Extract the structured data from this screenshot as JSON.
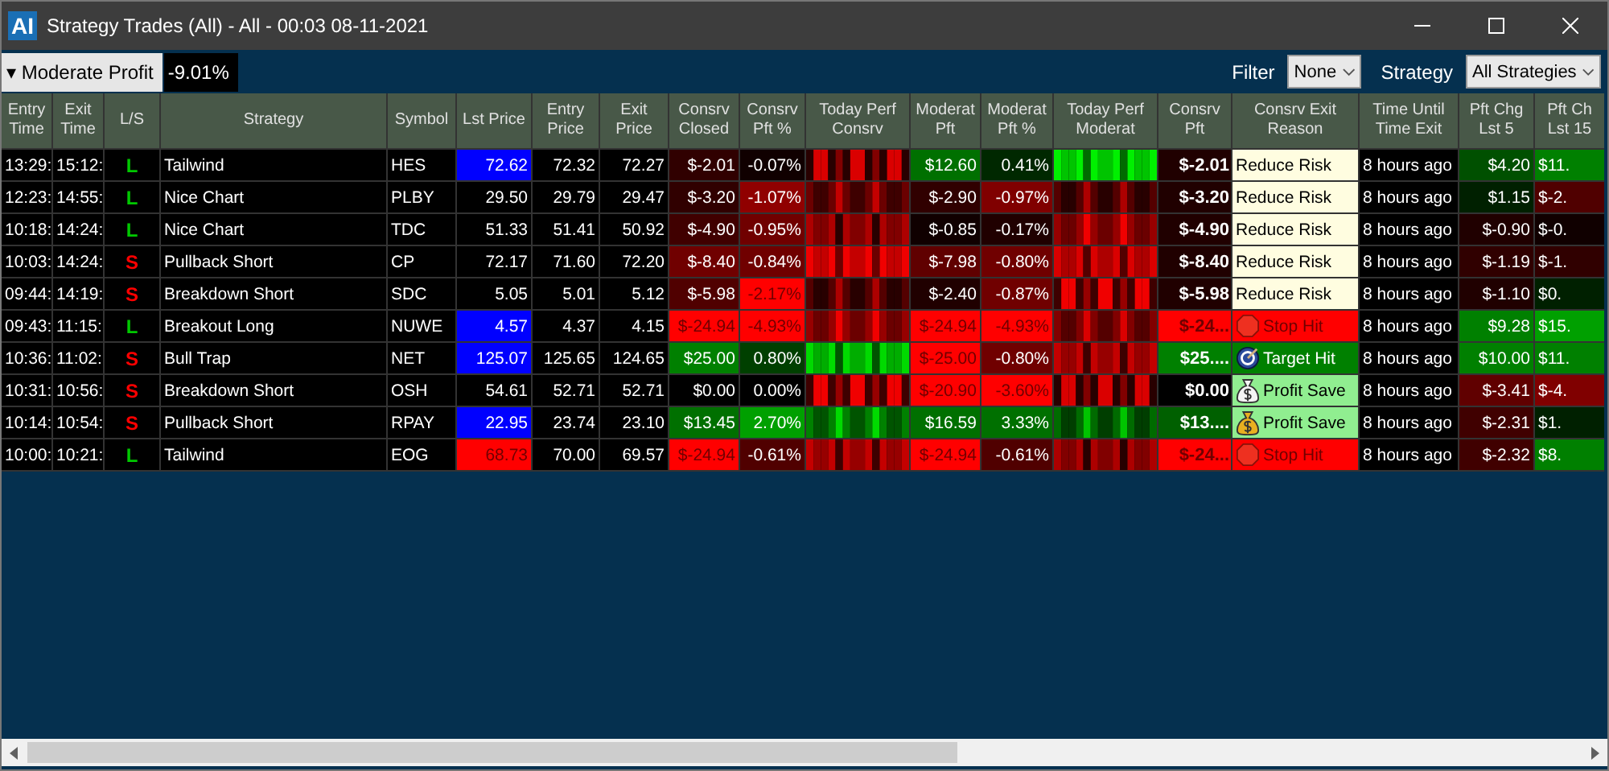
{
  "window": {
    "title": "Strategy Trades (All) - All - 00:03 08-11-2021",
    "logo": "AI"
  },
  "toolbar": {
    "view_button": "Moderate Profit",
    "view_caret": "▾",
    "total": "-9.01%",
    "filter_label": "Filter",
    "filter_value": "None",
    "strategy_label": "Strategy",
    "strategy_value": "All Strategies"
  },
  "columns": [
    {
      "label": "Entry Time"
    },
    {
      "label": "Exit Time"
    },
    {
      "label": "L/S"
    },
    {
      "label": "Strategy"
    },
    {
      "label": "Symbol"
    },
    {
      "label": "Lst Price"
    },
    {
      "label": "Entry Price"
    },
    {
      "label": "Exit Price"
    },
    {
      "label": "Consrv Closed"
    },
    {
      "label": "Consrv Pft %"
    },
    {
      "label": "Today Perf Consrv"
    },
    {
      "label": "Moderat Pft"
    },
    {
      "label": "Moderat Pft %"
    },
    {
      "label": "Today Perf Moderat"
    },
    {
      "label": "Consrv Pft"
    },
    {
      "label": "Consrv Exit Reason"
    },
    {
      "label": "Time Until Time Exit"
    },
    {
      "label": "Pft Chg Lst 5"
    },
    {
      "label": "Pft Ch Lst 15"
    }
  ],
  "rows": [
    {
      "entry": "13:29:",
      "exit": "15:12:",
      "side": {
        "text": "L",
        "color": "#00c800"
      },
      "strategy": "Tailwind",
      "symbol": "HES",
      "last": {
        "text": "72.62",
        "color": "#0000ff"
      },
      "entry_price": "72.32",
      "exit_price": "72.27",
      "c_closed": {
        "text": "$-2.01",
        "color": "#300000"
      },
      "c_pct": {
        "text": "-0.07%",
        "color": "#100000"
      },
      "m_pft": {
        "text": "$12.60",
        "color": "#007000"
      },
      "m_pct": {
        "text": "0.41%",
        "color": "#002800"
      },
      "c_pft": {
        "text": "$-2.01",
        "color": "#200000"
      },
      "reason": {
        "text": "Reduce Risk",
        "color": "#fffde0",
        "kind": "none"
      },
      "time_until": "8 hours ago",
      "chg5": {
        "text": "$4.20",
        "color": "#005000"
      },
      "chg15": {
        "text": "$11.",
        "color": "#008000"
      }
    },
    {
      "entry": "12:23:",
      "exit": "14:55:",
      "side": {
        "text": "L",
        "color": "#00c800"
      },
      "strategy": "Nice Chart",
      "symbol": "PLBY",
      "last": {
        "text": "29.50",
        "color": "#000000"
      },
      "entry_price": "29.79",
      "exit_price": "29.47",
      "c_closed": {
        "text": "$-3.20",
        "color": "#300000"
      },
      "c_pct": {
        "text": "-1.07%",
        "color": "#900000"
      },
      "m_pft": {
        "text": "$-2.90",
        "color": "#300000"
      },
      "m_pct": {
        "text": "-0.97%",
        "color": "#800000"
      },
      "c_pft": {
        "text": "$-3.20",
        "color": "#200000"
      },
      "reason": {
        "text": "Reduce Risk",
        "color": "#fffde0",
        "kind": "none"
      },
      "time_until": "8 hours ago",
      "chg5": {
        "text": "$1.15",
        "color": "#002000"
      },
      "chg15": {
        "text": "$-2.",
        "color": "#500000"
      }
    },
    {
      "entry": "10:18:",
      "exit": "14:24:",
      "side": {
        "text": "L",
        "color": "#00c800"
      },
      "strategy": "Nice Chart",
      "symbol": "TDC",
      "last": {
        "text": "51.33",
        "color": "#000000"
      },
      "entry_price": "51.41",
      "exit_price": "50.92",
      "c_closed": {
        "text": "$-4.90",
        "color": "#400000"
      },
      "c_pct": {
        "text": "-0.95%",
        "color": "#700000"
      },
      "m_pft": {
        "text": "$-0.85",
        "color": "#100000"
      },
      "m_pct": {
        "text": "-0.17%",
        "color": "#200000"
      },
      "c_pft": {
        "text": "$-4.90",
        "color": "#200000"
      },
      "reason": {
        "text": "Reduce Risk",
        "color": "#fffde0",
        "kind": "none"
      },
      "time_until": "8 hours ago",
      "chg5": {
        "text": "$-0.90",
        "color": "#200000"
      },
      "chg15": {
        "text": "$-0.",
        "color": "#100000"
      }
    },
    {
      "entry": "10:03:",
      "exit": "14:24:",
      "side": {
        "text": "S",
        "color": "#ff0000"
      },
      "strategy": "Pullback Short",
      "symbol": "CP",
      "last": {
        "text": "72.17",
        "color": "#000000"
      },
      "entry_price": "71.60",
      "exit_price": "72.20",
      "c_closed": {
        "text": "$-8.40",
        "color": "#700000"
      },
      "c_pct": {
        "text": "-0.84%",
        "color": "#700000"
      },
      "m_pft": {
        "text": "$-7.98",
        "color": "#600000"
      },
      "m_pct": {
        "text": "-0.80%",
        "color": "#700000"
      },
      "c_pft": {
        "text": "$-8.40",
        "color": "#200000"
      },
      "reason": {
        "text": "Reduce Risk",
        "color": "#fffde0",
        "kind": "none"
      },
      "time_until": "8 hours ago",
      "chg5": {
        "text": "$-1.19",
        "color": "#300000"
      },
      "chg15": {
        "text": "$-1.",
        "color": "#300000"
      }
    },
    {
      "entry": "09:44:",
      "exit": "14:19:",
      "side": {
        "text": "S",
        "color": "#ff0000"
      },
      "strategy": "Breakdown Short",
      "symbol": "SDC",
      "last": {
        "text": "5.05",
        "color": "#000000"
      },
      "entry_price": "5.01",
      "exit_price": "5.12",
      "c_closed": {
        "text": "$-5.98",
        "color": "#500000"
      },
      "c_pct": {
        "text": "-2.17%",
        "color": "#ff0000"
      },
      "m_pft": {
        "text": "$-2.40",
        "color": "#200000"
      },
      "m_pct": {
        "text": "-0.87%",
        "color": "#700000"
      },
      "c_pft": {
        "text": "$-5.98",
        "color": "#200000"
      },
      "reason": {
        "text": "Reduce Risk",
        "color": "#fffde0",
        "kind": "none"
      },
      "time_until": "8 hours ago",
      "chg5": {
        "text": "$-1.10",
        "color": "#200000"
      },
      "chg15": {
        "text": "$0.",
        "color": "#002000"
      }
    },
    {
      "entry": "09:43:",
      "exit": "11:15:",
      "side": {
        "text": "L",
        "color": "#00c800"
      },
      "strategy": "Breakout Long",
      "symbol": "NUWE",
      "last": {
        "text": "4.57",
        "color": "#0000ff"
      },
      "entry_price": "4.37",
      "exit_price": "4.15",
      "c_closed": {
        "text": "$-24.94",
        "color": "#ff0000"
      },
      "c_pct": {
        "text": "-4.93%",
        "color": "#ff0000"
      },
      "m_pft": {
        "text": "$-24.94",
        "color": "#ff0000"
      },
      "m_pct": {
        "text": "-4.93%",
        "color": "#ff0000"
      },
      "c_pft": {
        "text": "$-24...",
        "color": "#ff0000"
      },
      "reason": {
        "text": "Stop Hit",
        "color": "#ff0000",
        "kind": "stop"
      },
      "time_until": "8 hours ago",
      "chg5": {
        "text": "$9.28",
        "color": "#008000"
      },
      "chg15": {
        "text": "$15.",
        "color": "#00a000"
      }
    },
    {
      "entry": "10:36:",
      "exit": "11:02:",
      "side": {
        "text": "S",
        "color": "#ff0000"
      },
      "strategy": "Bull Trap",
      "symbol": "NET",
      "last": {
        "text": "125.07",
        "color": "#0000ff"
      },
      "entry_price": "125.65",
      "exit_price": "124.65",
      "c_closed": {
        "text": "$25.00",
        "color": "#008000"
      },
      "c_pct": {
        "text": "0.80%",
        "color": "#004000"
      },
      "m_pft": {
        "text": "$-25.00",
        "color": "#ff0000"
      },
      "m_pct": {
        "text": "-0.80%",
        "color": "#700000"
      },
      "c_pft": {
        "text": "$25....",
        "color": "#008000"
      },
      "reason": {
        "text": "Target Hit",
        "color": "#008000",
        "kind": "target"
      },
      "time_until": "8 hours ago",
      "chg5": {
        "text": "$10.00",
        "color": "#008000"
      },
      "chg15": {
        "text": "$11.",
        "color": "#008000"
      }
    },
    {
      "entry": "10:31:",
      "exit": "10:56:",
      "side": {
        "text": "S",
        "color": "#ff0000"
      },
      "strategy": "Breakdown Short",
      "symbol": "OSH",
      "last": {
        "text": "54.61",
        "color": "#000000"
      },
      "entry_price": "52.71",
      "exit_price": "52.71",
      "c_closed": {
        "text": "$0.00",
        "color": "#000000"
      },
      "c_pct": {
        "text": "0.00%",
        "color": "#000000"
      },
      "m_pft": {
        "text": "$-20.90",
        "color": "#ff0000"
      },
      "m_pct": {
        "text": "-3.60%",
        "color": "#ff0000"
      },
      "c_pft": {
        "text": "$0.00",
        "color": "#000000"
      },
      "reason": {
        "text": "Profit Save",
        "color": "#90ee90",
        "kind": "bag-silver"
      },
      "time_until": "8 hours ago",
      "chg5": {
        "text": "$-3.41",
        "color": "#600000"
      },
      "chg15": {
        "text": "$-4.",
        "color": "#800000"
      }
    },
    {
      "entry": "10:14:",
      "exit": "10:54:",
      "side": {
        "text": "S",
        "color": "#ff0000"
      },
      "strategy": "Pullback Short",
      "symbol": "RPAY",
      "last": {
        "text": "22.95",
        "color": "#0000ff"
      },
      "entry_price": "23.74",
      "exit_price": "23.10",
      "c_closed": {
        "text": "$13.45",
        "color": "#007000"
      },
      "c_pct": {
        "text": "2.70%",
        "color": "#00a000"
      },
      "m_pft": {
        "text": "$16.59",
        "color": "#007000"
      },
      "m_pct": {
        "text": "3.33%",
        "color": "#007000"
      },
      "c_pft": {
        "text": "$13....",
        "color": "#006000"
      },
      "reason": {
        "text": "Profit Save",
        "color": "#90ee90",
        "kind": "bag-gold"
      },
      "time_until": "8 hours ago",
      "chg5": {
        "text": "$-2.31",
        "color": "#400000"
      },
      "chg15": {
        "text": "$1.",
        "color": "#002000"
      }
    },
    {
      "entry": "10:00:",
      "exit": "10:21:",
      "side": {
        "text": "L",
        "color": "#00c800"
      },
      "strategy": "Tailwind",
      "symbol": "EOG",
      "last": {
        "text": "68.73",
        "color": "#ff0000"
      },
      "entry_price": "70.00",
      "exit_price": "69.57",
      "c_closed": {
        "text": "$-24.94",
        "color": "#ff0000"
      },
      "c_pct": {
        "text": "-0.61%",
        "color": "#500000"
      },
      "m_pft": {
        "text": "$-24.94",
        "color": "#ff0000"
      },
      "m_pct": {
        "text": "-0.61%",
        "color": "#500000"
      },
      "c_pft": {
        "text": "$-24...",
        "color": "#ff0000"
      },
      "reason": {
        "text": "Stop Hit",
        "color": "#ff0000",
        "kind": "stop"
      },
      "time_until": "8 hours ago",
      "chg5": {
        "text": "$-2.32",
        "color": "#400000"
      },
      "chg15": {
        "text": "$8.",
        "color": "#008000"
      }
    }
  ]
}
